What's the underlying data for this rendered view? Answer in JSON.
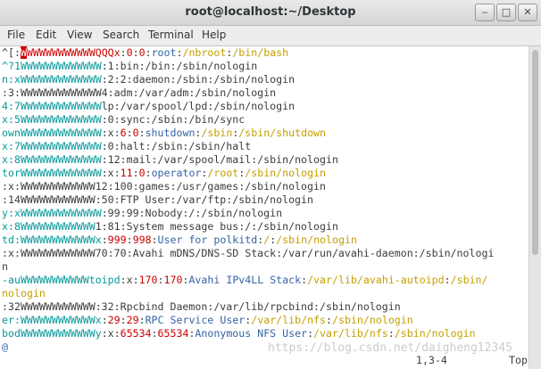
{
  "window": {
    "title": "root@localhost:~/Desktop",
    "minimize": "‒",
    "maximize": "□",
    "close": "✕"
  },
  "menu": [
    "File",
    "Edit",
    "View",
    "Search",
    "Terminal",
    "Help"
  ],
  "lines": [
    [
      [
        "d",
        "^[:"
      ],
      [
        "cursor",
        "W"
      ],
      [
        "r",
        "WWWWWWWWWWWQQQx"
      ],
      [
        "d",
        ":"
      ],
      [
        "r",
        "0"
      ],
      [
        "d",
        ":"
      ],
      [
        "r",
        "0"
      ],
      [
        "d",
        ":"
      ],
      [
        "b",
        "root"
      ],
      [
        "d",
        ":"
      ],
      [
        "o",
        "/nbroot"
      ],
      [
        "d",
        ":"
      ],
      [
        "o",
        "/bin/bash"
      ]
    ],
    [
      [
        "g",
        "^?1WWWWWWWWWWWWW"
      ],
      [
        "d",
        ":1:bin:/bin:/sbin/nologin"
      ]
    ],
    [
      [
        "g",
        "n:xWWWWWWWWWWWWW"
      ],
      [
        "d",
        ":2:2:daemon:/sbin:/sbin/nologin"
      ]
    ],
    [
      [
        "d",
        ":3:WWWWWWWWWWWWW4:adm:/var/adm:/sbin/nologin"
      ]
    ],
    [
      [
        "g",
        "4:7WWWWWWWWWWWWW"
      ],
      [
        "d",
        "lp:/var/spool/lpd:/sbin/nologin"
      ]
    ],
    [
      [
        "g",
        "x:5WWWWWWWWWWWWW"
      ],
      [
        "d",
        ":0:sync:/sbin:/bin/sync"
      ]
    ],
    [
      [
        "g",
        "ownWWWWWWWWWWWWW"
      ],
      [
        "d",
        ":x:"
      ],
      [
        "r",
        "6"
      ],
      [
        "d",
        ":"
      ],
      [
        "r",
        "0"
      ],
      [
        "d",
        ":"
      ],
      [
        "b",
        "shutdown"
      ],
      [
        "d",
        ":"
      ],
      [
        "o",
        "/sbin"
      ],
      [
        "d",
        ":"
      ],
      [
        "o",
        "/sbin/shutdown"
      ]
    ],
    [
      [
        "g",
        "x:7WWWWWWWWWWWWW"
      ],
      [
        "d",
        ":0:halt:/sbin:/sbin/halt"
      ]
    ],
    [
      [
        "g",
        "x:8WWWWWWWWWWWWW"
      ],
      [
        "d",
        ":12:mail:/var/spool/mail:/sbin/nologin"
      ]
    ],
    [
      [
        "g",
        "torWWWWWWWWWWWWW"
      ],
      [
        "d",
        ":x:"
      ],
      [
        "r",
        "11"
      ],
      [
        "d",
        ":"
      ],
      [
        "r",
        "0"
      ],
      [
        "d",
        ":"
      ],
      [
        "b",
        "operator"
      ],
      [
        "d",
        ":"
      ],
      [
        "o",
        "/root"
      ],
      [
        "d",
        ":"
      ],
      [
        "o",
        "/sbin/nologin"
      ]
    ],
    [
      [
        "d",
        ":x:WWWWWWWWWWWW12:100:games:/usr/games:/sbin/nologin"
      ]
    ],
    [
      [
        "d",
        ":14WWWWWWWWWWWW:50:FTP User:/var/ftp:/sbin/nologin"
      ]
    ],
    [
      [
        "g",
        "y:xWWWWWWWWWWWWW"
      ],
      [
        "d",
        ":99:99:Nobody:/:/sbin/nologin"
      ]
    ],
    [
      [
        "g",
        "x:8WWWWWWWWWWWW"
      ],
      [
        "d",
        "1:81:System message bus:/:/sbin/nologin"
      ]
    ],
    [
      [
        "g",
        "td:WWWWWWWWWWWWx"
      ],
      [
        "d",
        ":"
      ],
      [
        "r",
        "999"
      ],
      [
        "d",
        ":"
      ],
      [
        "r",
        "998"
      ],
      [
        "d",
        ":"
      ],
      [
        "b",
        "User for polkitd"
      ],
      [
        "d",
        ":"
      ],
      [
        "o",
        "/"
      ],
      [
        "d",
        ":"
      ],
      [
        "o",
        "/sbin/nologin"
      ]
    ],
    [
      [
        "d",
        ":x:WWWWWWWWWWWW70:70:Avahi mDNS/DNS-SD Stack:/var/run/avahi-daemon:/sbin/nologi"
      ]
    ],
    [
      [
        "d",
        "n"
      ]
    ],
    [
      [
        "g",
        "-auWWWWWWWWWWWtoipd"
      ],
      [
        "d",
        ":x:"
      ],
      [
        "r",
        "170"
      ],
      [
        "d",
        ":"
      ],
      [
        "r",
        "170"
      ],
      [
        "d",
        ":"
      ],
      [
        "b",
        "Avahi IPv4LL Stack"
      ],
      [
        "d",
        ":"
      ],
      [
        "o",
        "/var/lib/avahi-autoipd"
      ],
      [
        "d",
        ":"
      ],
      [
        "o",
        "/sbin/"
      ]
    ],
    [
      [
        "o",
        "nologin"
      ]
    ],
    [
      [
        "d",
        ":32WWWWWWWWWWWW:32:Rpcbind Daemon:/var/lib/rpcbind:/sbin/nologin"
      ]
    ],
    [
      [
        "g",
        "er:WWWWWWWWWWWWx"
      ],
      [
        "d",
        ":"
      ],
      [
        "r",
        "29"
      ],
      [
        "d",
        ":"
      ],
      [
        "r",
        "29"
      ],
      [
        "d",
        ":"
      ],
      [
        "b",
        "RPC Service User"
      ],
      [
        "d",
        ":"
      ],
      [
        "o",
        "/var/lib/nfs"
      ],
      [
        "d",
        ":"
      ],
      [
        "o",
        "/sbin/nologin"
      ]
    ],
    [
      [
        "g",
        "bodWWWWWWWWWWWWy"
      ],
      [
        "d",
        ":x:"
      ],
      [
        "r",
        "65534"
      ],
      [
        "d",
        ":"
      ],
      [
        "r",
        "65534"
      ],
      [
        "d",
        ":"
      ],
      [
        "b",
        "Anonymous NFS User"
      ],
      [
        "d",
        ":"
      ],
      [
        "o",
        "/var/lib/nfs"
      ],
      [
        "d",
        ":"
      ],
      [
        "o",
        "/sbin/nologin"
      ]
    ],
    [
      [
        "b",
        "@"
      ]
    ]
  ],
  "status": {
    "position": "1,3-4",
    "scroll": "Top"
  },
  "watermark": "https://blog.csdn.net/daigheng12345"
}
